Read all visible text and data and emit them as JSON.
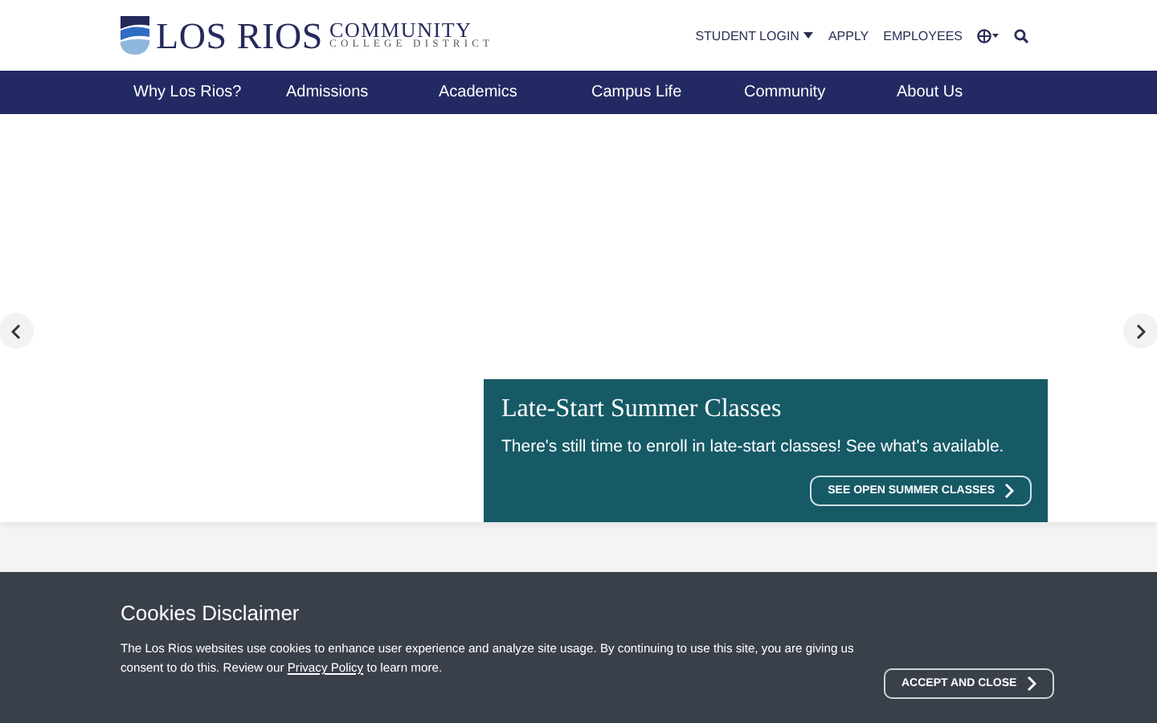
{
  "header": {
    "logo": {
      "name": "LOS RIOS",
      "line1": "COMMUNITY",
      "line2": "COLLEGE DISTRICT"
    },
    "utility_links": [
      {
        "label": "STUDENT LOGIN",
        "has_menu": true
      },
      {
        "label": "APPLY",
        "has_menu": false
      },
      {
        "label": "EMPLOYEES",
        "has_menu": false
      }
    ]
  },
  "nav": {
    "items": [
      "Why Los Rios?",
      "Admissions",
      "Academics",
      "Campus Life",
      "Community",
      "About Us"
    ]
  },
  "hero": {
    "title": "Late-Start Summer Classes",
    "text": "There's still time to enroll in late-start classes! See what's available.",
    "button": "SEE OPEN SUMMER CLASSES"
  },
  "cookies": {
    "title": "Cookies Disclaimer",
    "text_before": "The Los Rios websites use cookies to enhance user experience and analyze site usage. By continuing to use this site, you are giving us consent to do this. Review our ",
    "link": "Privacy Policy",
    "text_after": " to learn more.",
    "button": "ACCEPT AND CLOSE"
  }
}
